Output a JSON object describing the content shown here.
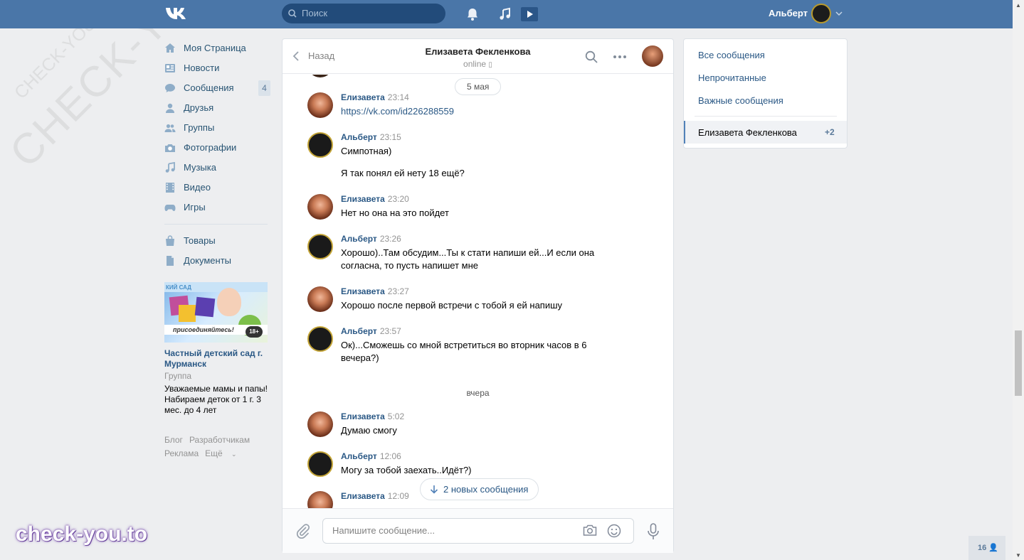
{
  "header": {
    "search_placeholder": "Поиск",
    "user_name": "Альберт",
    "icons": [
      "vk-logo-icon",
      "bell-icon",
      "music-icon",
      "play-icon",
      "chevron-down-icon"
    ]
  },
  "sidebar": {
    "items": [
      {
        "label": "Моя Страница",
        "icon": "home-icon"
      },
      {
        "label": "Новости",
        "icon": "news-icon"
      },
      {
        "label": "Сообщения",
        "icon": "messages-icon",
        "badge": "4"
      },
      {
        "label": "Друзья",
        "icon": "user-icon"
      },
      {
        "label": "Группы",
        "icon": "users-icon"
      },
      {
        "label": "Фотографии",
        "icon": "camera-icon"
      },
      {
        "label": "Музыка",
        "icon": "music-icon"
      },
      {
        "label": "Видео",
        "icon": "film-icon"
      },
      {
        "label": "Игры",
        "icon": "gamepad-icon"
      }
    ],
    "items2": [
      {
        "label": "Товары",
        "icon": "bag-icon"
      },
      {
        "label": "Документы",
        "icon": "document-icon"
      }
    ],
    "ad": {
      "title": "Частный детский сад г. Мурманск",
      "subtitle": "Группа",
      "text": "Уважаемые мамы и папы! Набираем деток от 1 г. 3 мес. до 4 лет",
      "banner_top": "КИЙ САД",
      "banner_cta": "присоединяйтесь!",
      "banner_age": "18+"
    },
    "footer": {
      "blog": "Блог",
      "devs": "Разработчикам",
      "ads": "Реклама",
      "more": "Ещё"
    }
  },
  "chat": {
    "back_label": "Назад",
    "peer_name": "Елизавета Фекленкова",
    "peer_status": "online",
    "date_pill": "5 мая",
    "day_separator": "вчера",
    "new_messages": "2 новых сообщения",
    "compose_placeholder": "Напишите сообщение...",
    "messages": [
      {
        "author": "Елизавета",
        "time": "23:14",
        "text": "https://vk.com/id226288559",
        "who": "liza"
      },
      {
        "author": "Альберт",
        "time": "23:15",
        "text": "Симпотная)",
        "text2": "Я так понял ей нету 18 ещё?",
        "who": "alb"
      },
      {
        "author": "Елизавета",
        "time": "23:20",
        "text": "Нет но она на это пойдет",
        "who": "liza"
      },
      {
        "author": "Альберт",
        "time": "23:26",
        "text": "Хорошо)..Там обсудим...Ты к стати напиши ей...И если она согласна, то пусть напишет мне",
        "who": "alb"
      },
      {
        "author": "Елизавета",
        "time": "23:27",
        "text": "Хорошо после первой встречи с тобой я ей напишу",
        "who": "liza"
      },
      {
        "author": "Альберт",
        "time": "23:57",
        "text": "Ок)...Сможешь со мной встретиться во вторник часов в 6 вечера?)",
        "who": "alb"
      },
      {
        "author": "Елизавета",
        "time": "5:02",
        "text": "Думаю смогу",
        "who": "liza"
      },
      {
        "author": "Альберт",
        "time": "12:06",
        "text": "Могу за тобой заехать..Идёт?)",
        "who": "alb"
      },
      {
        "author": "Елизавета",
        "time": "12:09",
        "text": "",
        "who": "liza"
      }
    ]
  },
  "right_panel": {
    "all": "Все сообщения",
    "unread": "Непрочитанные",
    "important": "Важные сообщения",
    "active_name": "Елизавета Фекленкова",
    "active_count": "+2"
  },
  "online_count": "16",
  "watermarks": {
    "big": "CHECK-YOU.ME",
    "small": "CHECK-YOU.ME",
    "bottom": "check-you.to"
  },
  "colors": {
    "header_bg": "#4a76a8",
    "link": "#2a5885",
    "page_bg": "#edeef0"
  }
}
